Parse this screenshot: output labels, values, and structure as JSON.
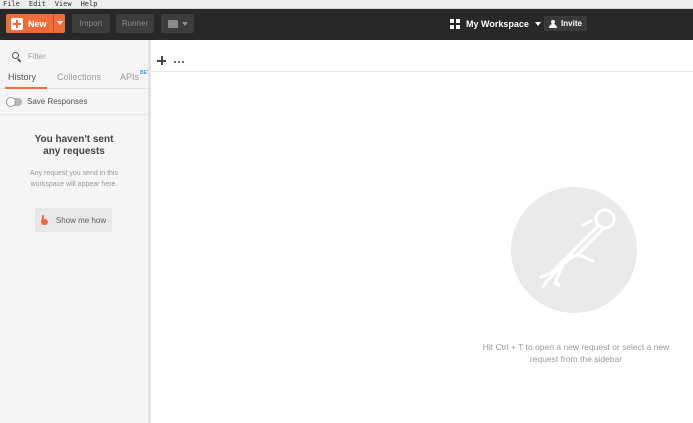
{
  "menubar": {
    "items": [
      "File",
      "Edit",
      "View",
      "Help"
    ]
  },
  "toolbar": {
    "new_label": "New",
    "import_label": "Import",
    "runner_label": "Runner",
    "workspace_label": "My Workspace",
    "invite_label": "Invite"
  },
  "sidebar": {
    "filter_placeholder": "Filter",
    "tabs": {
      "history": "History",
      "collections": "Collections",
      "apis": "APIs",
      "apis_badge": "BETA"
    },
    "save_responses_label": "Save Responses",
    "empty_title": "You haven't sent any requests",
    "empty_description": "Any request you send in this workspace will appear here.",
    "show_me_how_label": "Show me how"
  },
  "main": {
    "hint": "Hit Ctrl + T to open a new request or select a new request from the sidebar"
  },
  "colors": {
    "accent": "#f26b3a",
    "toolbar_bg": "#282828",
    "sidebar_bg": "#f5f5f5",
    "logo_circle": "#eaeaea"
  }
}
